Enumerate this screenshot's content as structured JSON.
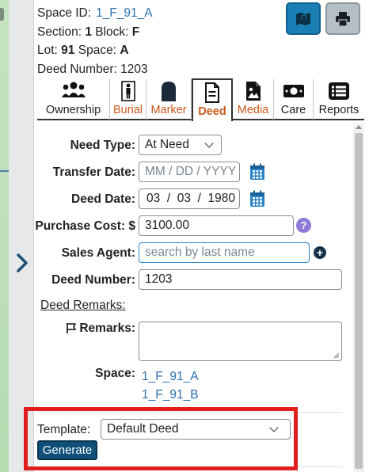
{
  "header": {
    "space_id_label": "Space ID:",
    "space_id": "1_F_91_A",
    "section_label": "Section:",
    "section": "1",
    "block_label": "Block:",
    "block": "F",
    "lot_label": "Lot:",
    "lot": "91",
    "space_label": "Space:",
    "space": "A",
    "deed_number_label": "Deed Number:",
    "deed_number": "1203"
  },
  "tabs": [
    {
      "label": "Ownership",
      "icon": "people-icon"
    },
    {
      "label": "Burial",
      "icon": "person-icon"
    },
    {
      "label": "Marker",
      "icon": "headstone-icon"
    },
    {
      "label": "Deed",
      "icon": "document-icon"
    },
    {
      "label": "Media",
      "icon": "image-file-icon"
    },
    {
      "label": "Care",
      "icon": "money-icon"
    },
    {
      "label": "Reports",
      "icon": "list-icon"
    }
  ],
  "form": {
    "need_type_label": "Need Type:",
    "need_type_value": "At Need",
    "transfer_date_label": "Transfer Date:",
    "transfer_date_placeholder": "MM / DD / YYYY",
    "deed_date_label": "Deed Date:",
    "deed_date_value": "03  /  03  /  1980",
    "purchase_cost_label": "Purchase Cost: $",
    "purchase_cost_value": "3100.00",
    "help_glyph": "?",
    "sales_agent_label": "Sales Agent:",
    "sales_agent_placeholder": "search by last name",
    "add_glyph": "+",
    "deed_number_label": "Deed Number:",
    "deed_number_value": "1203",
    "deed_remarks_link": "Deed Remarks:",
    "remarks_label": "Remarks:",
    "remarks_value": "",
    "space_label": "Space:",
    "space_links": [
      "1_F_91_A",
      "1_F_91_B"
    ]
  },
  "template": {
    "label": "Template:",
    "value": "Default Deed",
    "generate_label": "Generate"
  },
  "colors": {
    "accent_blue": "#1b7fb5",
    "active_tab_text": "#c8581b",
    "link": "#2a6fb0",
    "highlight_box": "#e01e1e",
    "generate_button": "#0f4f78",
    "help_badge": "#8e7ad8"
  }
}
